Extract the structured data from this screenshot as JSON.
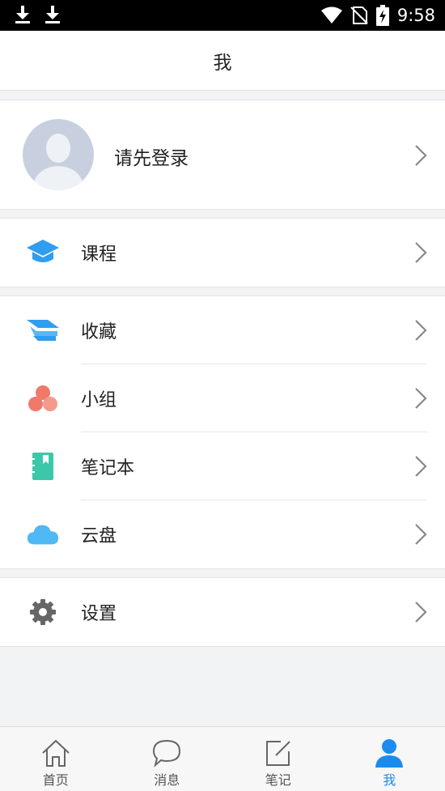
{
  "status_bar": {
    "time": "9:58"
  },
  "header": {
    "title": "我"
  },
  "profile": {
    "login_text": "请先登录"
  },
  "menu": {
    "courses": {
      "label": "课程",
      "icon": "graduation-cap-icon"
    },
    "favorites": {
      "label": "收藏",
      "icon": "bookmark-stack-icon"
    },
    "groups": {
      "label": "小组",
      "icon": "group-circles-icon"
    },
    "notebook": {
      "label": "笔记本",
      "icon": "notebook-icon"
    },
    "cloud": {
      "label": "云盘",
      "icon": "cloud-icon"
    },
    "settings": {
      "label": "设置",
      "icon": "gear-icon"
    }
  },
  "tabs": [
    {
      "label": "首页",
      "icon": "home-icon",
      "active": false
    },
    {
      "label": "消息",
      "icon": "chat-bubble-icon",
      "active": false
    },
    {
      "label": "笔记",
      "icon": "edit-note-icon",
      "active": false
    },
    {
      "label": "我",
      "icon": "person-icon",
      "active": true
    }
  ],
  "colors": {
    "accent": "#1a8cf0",
    "courses": "#2f9df0",
    "favorites": "#2f9df0",
    "groups": "#f07a6a",
    "notebook": "#3cc8a8",
    "cloud": "#4fb8f5",
    "settings": "#666666"
  }
}
